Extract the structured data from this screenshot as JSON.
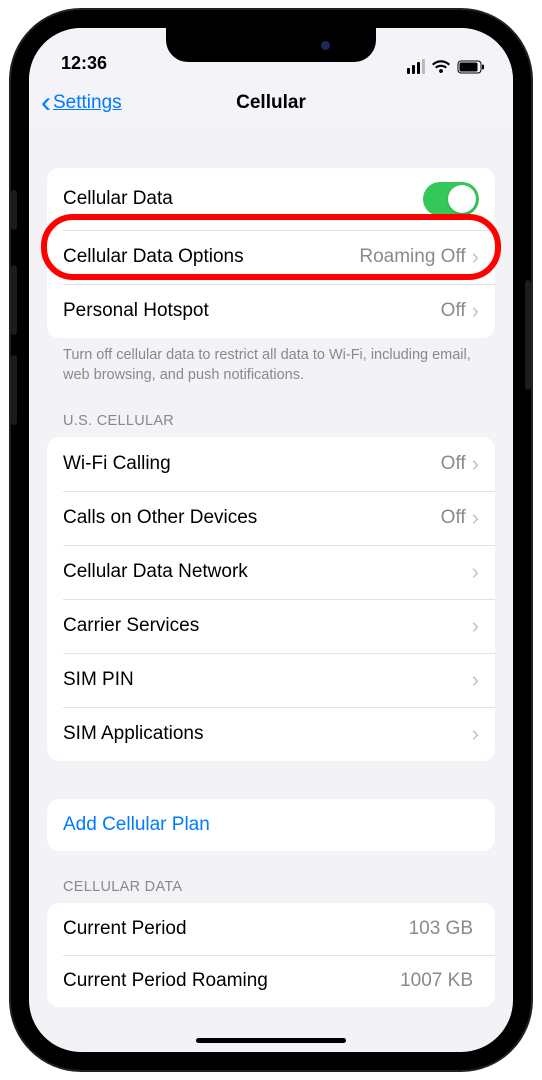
{
  "status": {
    "time": "12:36"
  },
  "nav": {
    "back": "Settings",
    "title": "Cellular"
  },
  "group1": {
    "cellular_data": "Cellular Data",
    "cellular_data_options": "Cellular Data Options",
    "cellular_data_options_detail": "Roaming Off",
    "personal_hotspot": "Personal Hotspot",
    "personal_hotspot_detail": "Off",
    "footer": "Turn off cellular data to restrict all data to Wi-Fi, including email, web browsing, and push notifications."
  },
  "carrier": {
    "header": "U.S. CELLULAR",
    "rows": [
      {
        "label": "Wi-Fi Calling",
        "detail": "Off"
      },
      {
        "label": "Calls on Other Devices",
        "detail": "Off"
      },
      {
        "label": "Cellular Data Network",
        "detail": ""
      },
      {
        "label": "Carrier Services",
        "detail": ""
      },
      {
        "label": "SIM PIN",
        "detail": ""
      },
      {
        "label": "SIM Applications",
        "detail": ""
      }
    ]
  },
  "add_plan": "Add Cellular Plan",
  "usage": {
    "header": "CELLULAR DATA",
    "rows": [
      {
        "label": "Current Period",
        "detail": "103 GB"
      },
      {
        "label": "Current Period Roaming",
        "detail": "1007 KB"
      }
    ]
  }
}
